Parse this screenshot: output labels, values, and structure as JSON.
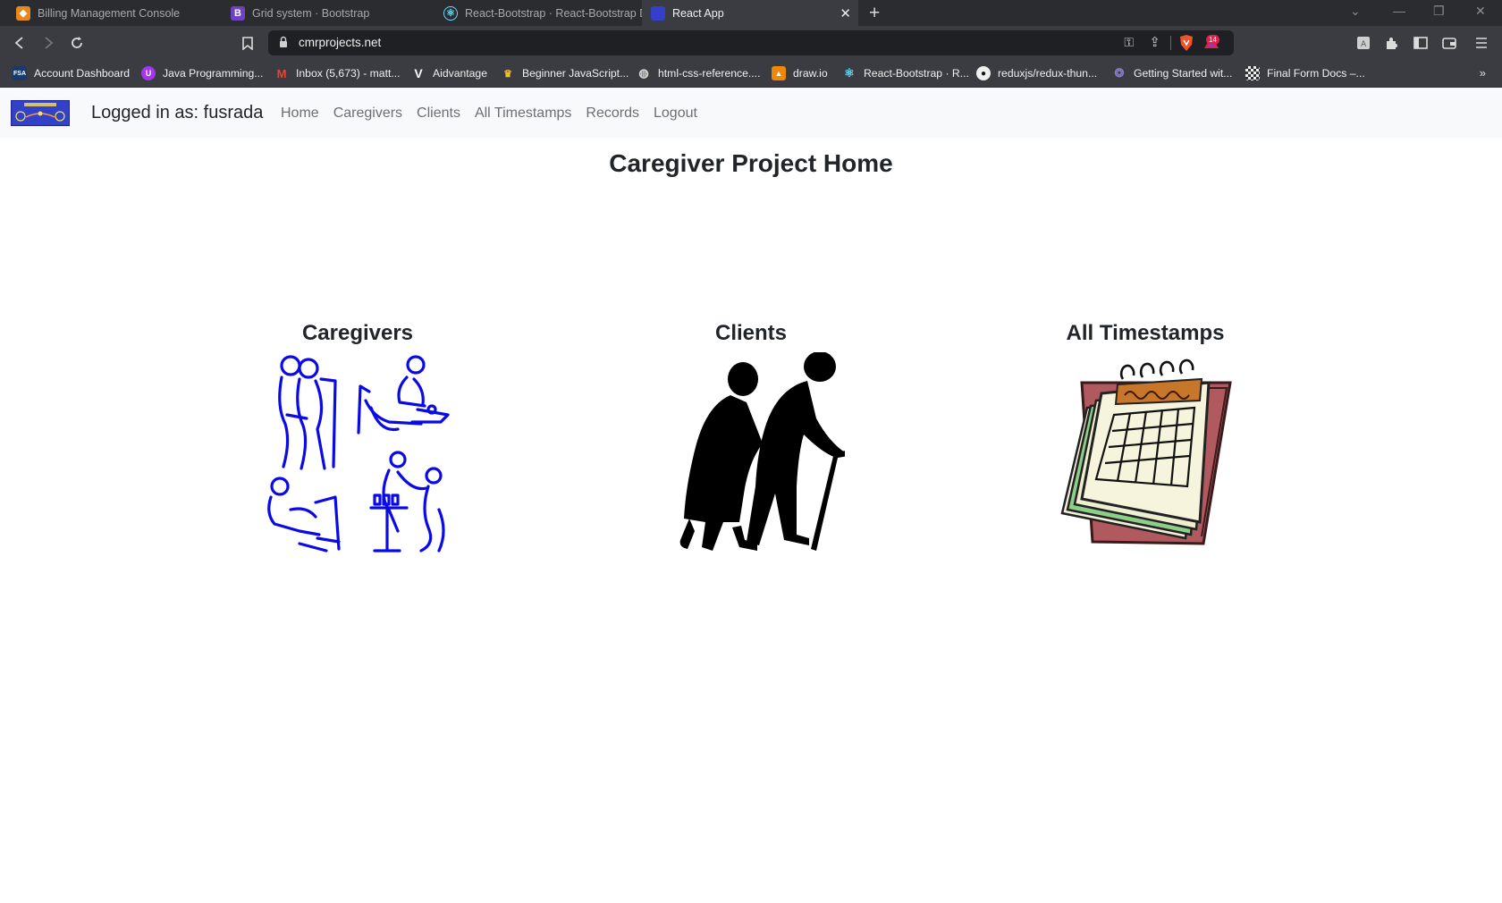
{
  "browser": {
    "tabs": [
      {
        "title": "Billing Management Console",
        "icon": "aws-cube-icon"
      },
      {
        "title": "Grid system · Bootstrap",
        "icon": "bootstrap-icon"
      },
      {
        "title": "React-Bootstrap · React-Bootstrap Doc",
        "icon": "react-bootstrap-icon"
      },
      {
        "title": "React App",
        "icon": "react-app-icon",
        "active": true
      }
    ],
    "url": "cmrprojects.net",
    "rewards_badge": "14",
    "bookmarks": [
      {
        "label": "Account Dashboard",
        "icon": "fsa-icon"
      },
      {
        "label": "Java Programming...",
        "icon": "udemy-icon"
      },
      {
        "label": "Inbox (5,673) - matt...",
        "icon": "gmail-icon"
      },
      {
        "label": "Aidvantage",
        "icon": "aidvantage-icon"
      },
      {
        "label": "Beginner JavaScript...",
        "icon": "crown-icon"
      },
      {
        "label": "html-css-reference....",
        "icon": "globe-icon"
      },
      {
        "label": "draw.io",
        "icon": "drawio-icon"
      },
      {
        "label": "React-Bootstrap · R...",
        "icon": "react-bootstrap-icon"
      },
      {
        "label": "reduxjs/redux-thun...",
        "icon": "github-icon"
      },
      {
        "label": "Getting Started wit...",
        "icon": "redux-icon"
      },
      {
        "label": "Final Form Docs –...",
        "icon": "checkered-flag-icon"
      }
    ]
  },
  "navbar": {
    "logo_icon": "caregiver-project-logo-icon",
    "logged_in": "Logged in as: fusrada",
    "links": [
      "Home",
      "Caregivers",
      "Clients",
      "All Timestamps",
      "Records",
      "Logout"
    ]
  },
  "page": {
    "title": "Caregiver Project Home",
    "cards": [
      {
        "title": "Caregivers",
        "image": "caregivers-illustration"
      },
      {
        "title": "Clients",
        "image": "elderly-couple-silhouette"
      },
      {
        "title": "All Timestamps",
        "image": "calendar-clipart"
      }
    ]
  },
  "colors": {
    "chrome_bg": "#2b2c30",
    "toolbar_bg": "#3b3c42",
    "navbar_bg": "#f8f9fa",
    "caregivers_blue": "#0a0ae6",
    "calendar_back": "#b05a60"
  }
}
